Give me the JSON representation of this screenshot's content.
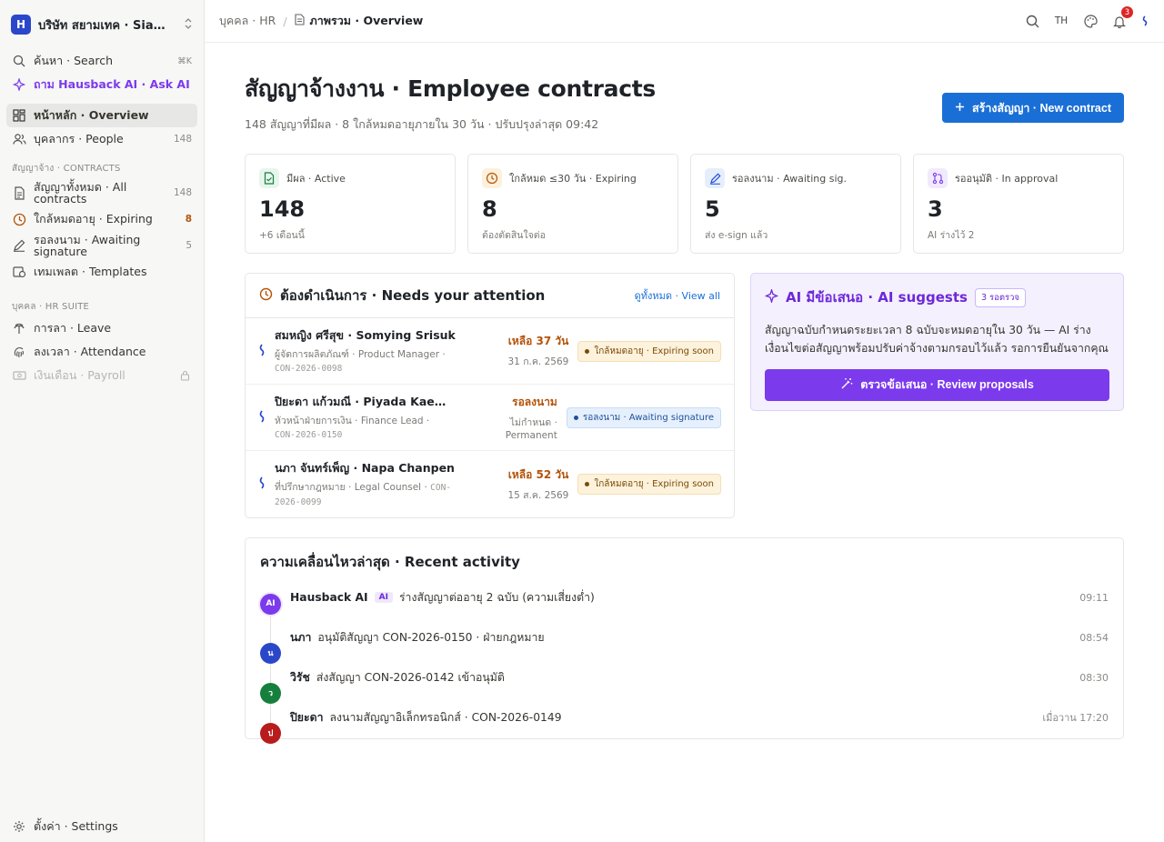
{
  "workspace": {
    "logo": "H",
    "name": "บริษัท สยามเทค · SiamT..."
  },
  "sidebar": {
    "search": {
      "label": "ค้นหา · Search",
      "shortcut": "⌘K"
    },
    "ask_ai": "ถาม Hausback AI · Ask AI",
    "overview": "หน้าหลัก · Overview",
    "people": {
      "label": "บุคลากร · People",
      "count": "148"
    },
    "contracts_section": "สัญญาจ้าง · CONTRACTS",
    "all_contracts": {
      "label": "สัญญาทั้งหมด · All contracts",
      "count": "148"
    },
    "expiring": {
      "label": "ใกล้หมดอายุ · Expiring",
      "count": "8"
    },
    "awaiting": {
      "label": "รอลงนาม · Awaiting signature",
      "count": "5"
    },
    "templates": "เทมเพลต · Templates",
    "hr_section": "บุคคล · HR SUITE",
    "leave": "การลา · Leave",
    "attendance": "ลงเวลา · Attendance",
    "payroll": "เงินเดือน · Payroll",
    "settings": "ตั้งค่า · Settings"
  },
  "topbar": {
    "crumb_parent": "บุคคล · HR",
    "crumb_current": "ภาพรวม · Overview",
    "lang": "TH",
    "notifications": "3"
  },
  "page": {
    "title": "สัญญาจ้างงาน · Employee contracts",
    "subtitle": "148 สัญญาที่มีผล · 8 ใกล้หมดอายุภายใน 30 วัน · ปรับปรุงล่าสุด 09:42",
    "new_button": "สร้างสัญญา · New contract"
  },
  "stats": [
    {
      "label": "มีผล · Active",
      "value": "148",
      "note": "+6 เดือนนี้",
      "color": "#15803d",
      "bg": "#e7f6ec"
    },
    {
      "label": "ใกล้หมด ≤30 วัน · Expiring",
      "value": "8",
      "note": "ต้องตัดสินใจต่อ",
      "color": "#b45309",
      "bg": "#fdf1dc"
    },
    {
      "label": "รอลงนาม · Awaiting sig.",
      "value": "5",
      "note": "ส่ง e-sign แล้ว",
      "color": "#1d4ed8",
      "bg": "#e6eefc"
    },
    {
      "label": "รออนุมัติ · In approval",
      "value": "3",
      "note": "AI ร่างไว้ 2",
      "color": "#7c3aed",
      "bg": "#f1eafd"
    }
  ],
  "attention": {
    "title": "ต้องดำเนินการ · Needs your attention",
    "view_all": "ดูทั้งหมด · View all",
    "rows": [
      {
        "name": "สมหญิง ศรีสุข · Somying Srisuk",
        "role": "ผู้จัดการผลิตภัณฑ์ · Product Manager · ",
        "code": "CON-2026-0098",
        "due": "เหลือ 37 วัน",
        "date": "31 ก.ค. 2569",
        "status": "ใกล้หมดอายุ · Expiring soon"
      },
      {
        "name": "ปิยะดา แก้วมณี · Piyada Kaewma...",
        "role": "หัวหน้าฝ่ายการเงิน · Finance Lead · ",
        "code": "CON-2026-0150",
        "due": "รอลงนาม",
        "date": "ไม่กำหนด · Permanent",
        "status": "รอลงนาม · Awaiting signature"
      },
      {
        "name": "นภา จันทร์เพ็ญ · Napa Chanpen",
        "role": "ที่ปรึกษากฎหมาย · Legal Counsel · ",
        "code": "CON-2026-0099",
        "due": "เหลือ 52 วัน",
        "date": "15 ส.ค. 2569",
        "status": "ใกล้หมดอายุ · Expiring soon"
      }
    ]
  },
  "ai_suggest": {
    "title": "AI มีข้อเสนอ · AI suggests",
    "chip": "3 รอตรวจ",
    "text": "สัญญาฉบับกำหนดระยะเวลา 8 ฉบับจะหมดอายุใน 30 วัน — AI ร่างเงื่อนไขต่อสัญญาพร้อมปรับค่าจ้างตามกรอบไว้แล้ว รอการยืนยันจากคุณ",
    "button": "ตรวจข้อเสนอ · Review proposals"
  },
  "activity": {
    "title": "ความเคลื่อนไหวล่าสุด · Recent activity",
    "items": [
      {
        "avatar": "AI",
        "name": "Hausback AI",
        "tag": "AI",
        "text": "ร่างสัญญาต่ออายุ 2 ฉบับ (ความเสี่ยงต่ำ)",
        "time": "09:11",
        "color": "#7c3aed"
      },
      {
        "avatar": "น",
        "name": "นภา",
        "tag": "",
        "text": "อนุมัติสัญญา CON-2026-0150 · ฝ่ายกฎหมาย",
        "time": "08:54",
        "color": "#2b47c9"
      },
      {
        "avatar": "ว",
        "name": "วิรัช",
        "tag": "",
        "text": "ส่งสัญญา CON-2026-0142 เข้าอนุมัติ",
        "time": "08:30",
        "color": "#15803d"
      },
      {
        "avatar": "ป",
        "name": "ปิยะดา",
        "tag": "",
        "text": "ลงนามสัญญาอิเล็กทรอนิกส์ · CON-2026-0149",
        "time": "เมื่อวาน 17:20",
        "color": "#b91c1c"
      }
    ]
  }
}
